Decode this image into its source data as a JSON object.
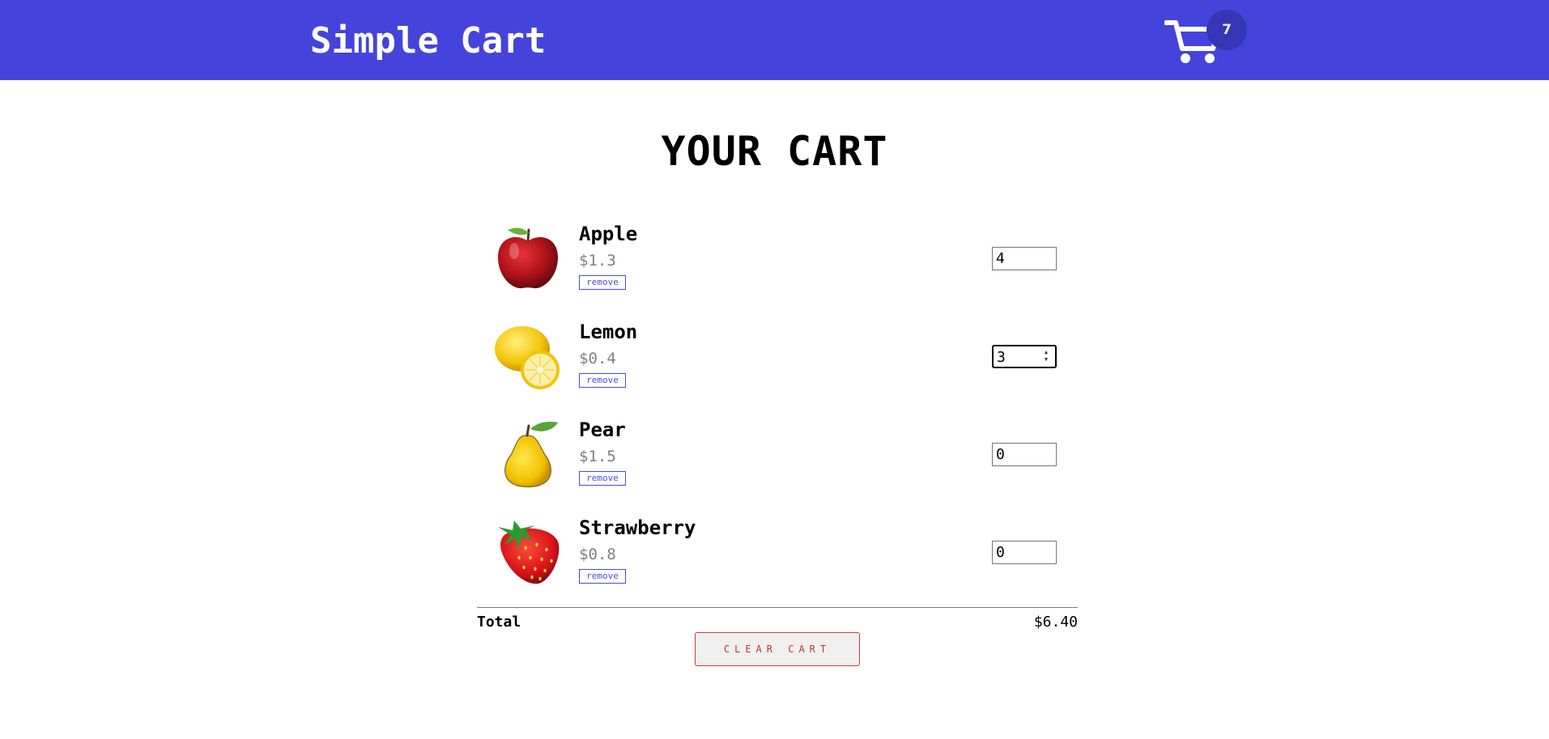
{
  "header": {
    "brand": "Simple Cart",
    "cart_count": "7",
    "cart_icon": "shopping-cart-icon",
    "background_color": "#4444dd"
  },
  "main": {
    "title": "YOUR CART"
  },
  "items": [
    {
      "name": "Apple",
      "price": "$1.3",
      "remove_label": "remove",
      "quantity": "4",
      "image_icon": "apple-icon"
    },
    {
      "name": "Lemon",
      "price": "$0.4",
      "remove_label": "remove",
      "quantity": "3",
      "image_icon": "lemon-icon"
    },
    {
      "name": "Pear",
      "price": "$1.5",
      "remove_label": "remove",
      "quantity": "0",
      "image_icon": "pear-icon"
    },
    {
      "name": "Strawberry",
      "price": "$0.8",
      "remove_label": "remove",
      "quantity": "0",
      "image_icon": "strawberry-icon"
    }
  ],
  "summary": {
    "total_label": "Total",
    "total_value": "$6.40",
    "clear_label": "CLEAR CART"
  },
  "colors": {
    "accent": "#4444dd",
    "remove": "#4a4adf",
    "clear": "#c0392b"
  }
}
